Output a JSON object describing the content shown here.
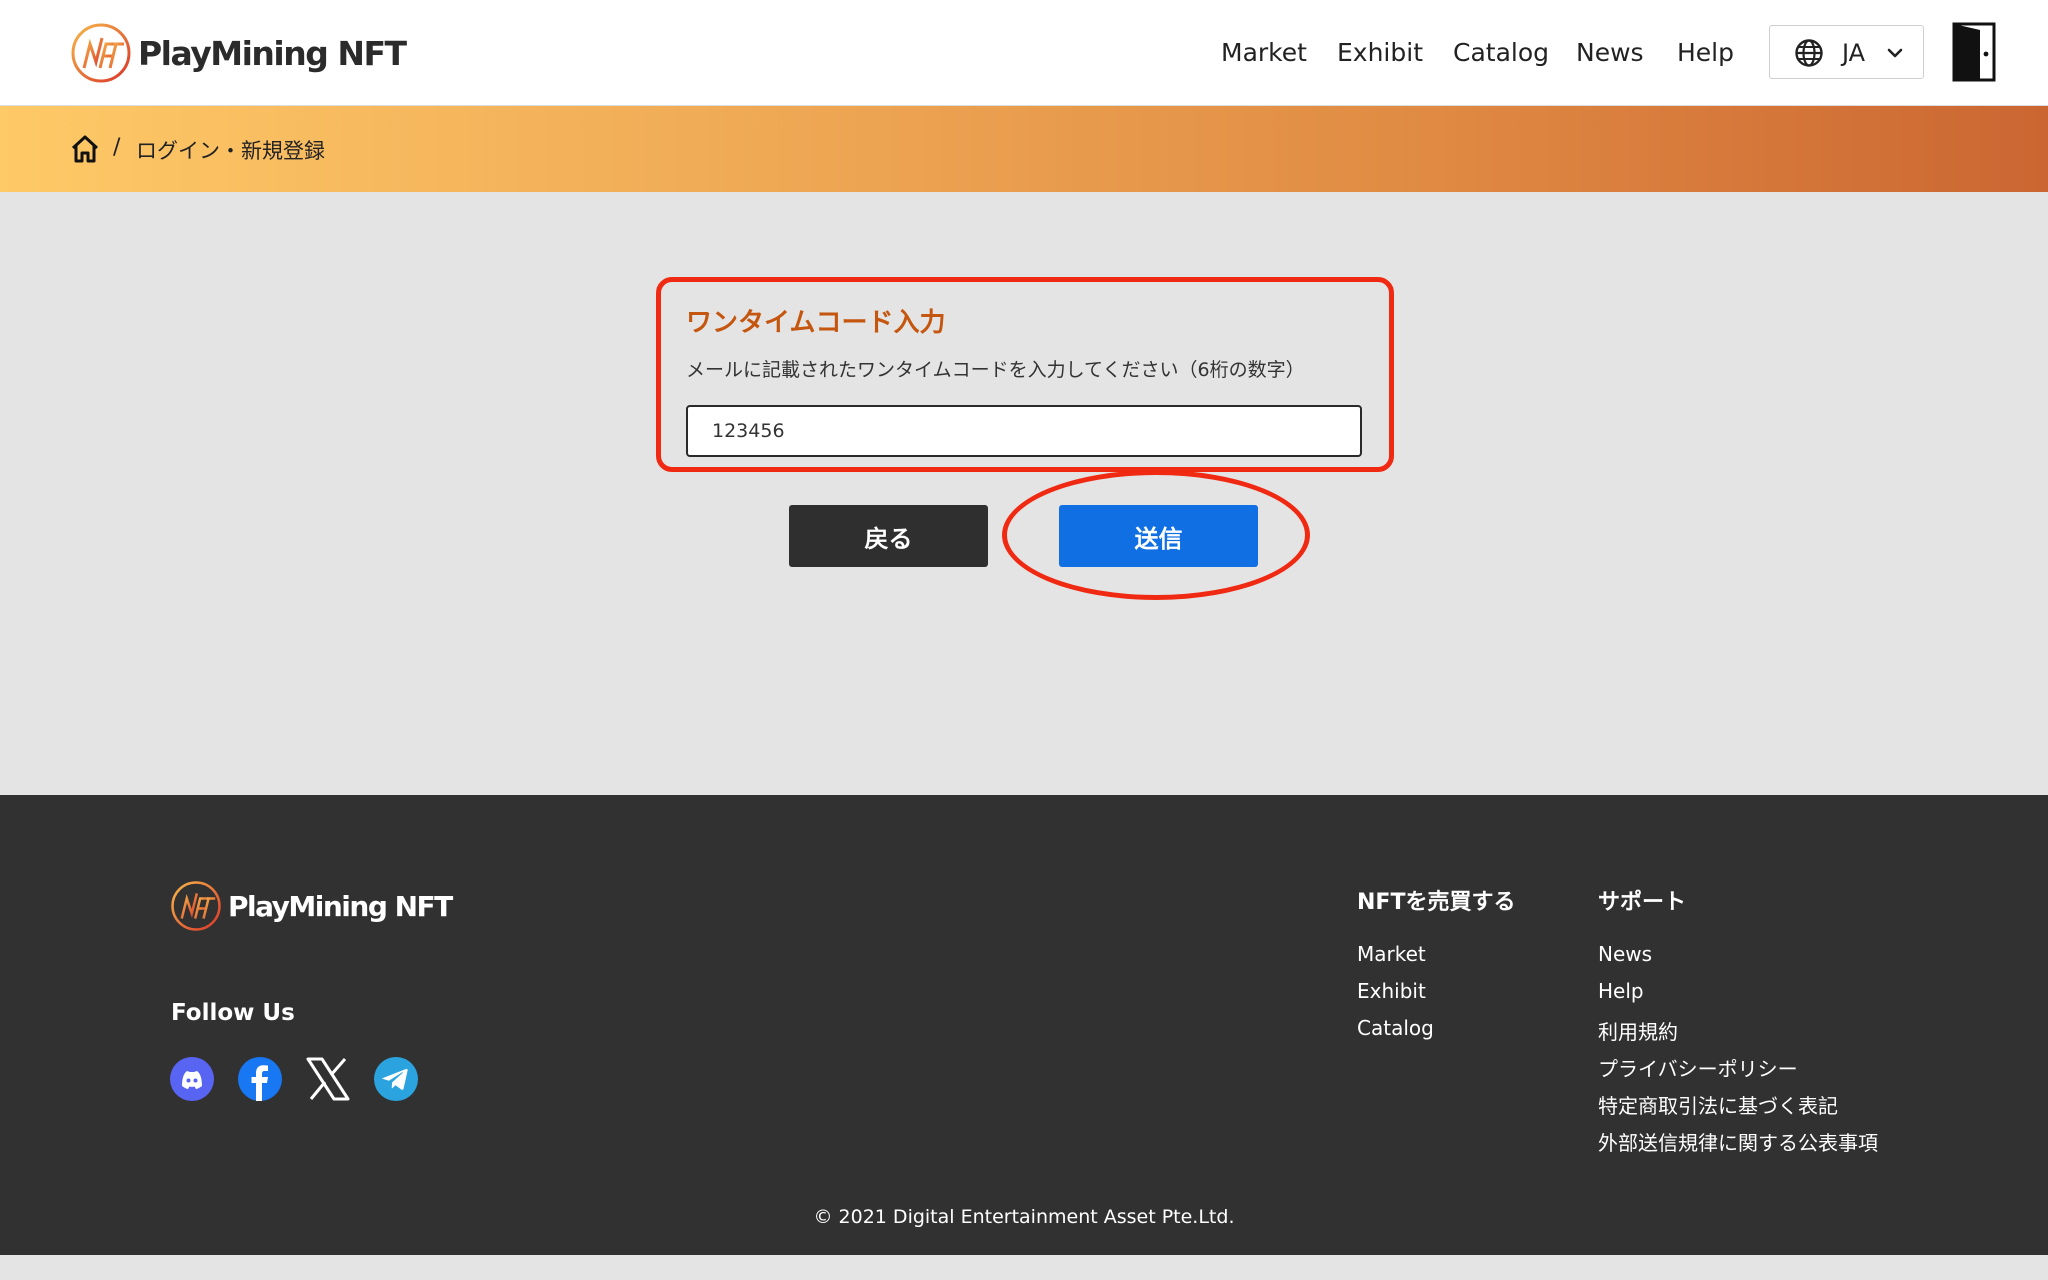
{
  "brand": {
    "name": "PlayMining NFT",
    "accent": "#c4560f",
    "highlight": "#f02a12"
  },
  "header": {
    "nav": [
      "Market",
      "Exhibit",
      "Catalog",
      "News",
      "Help"
    ],
    "language": "JA",
    "icons": [
      "globe-icon",
      "chevron-down-icon",
      "door-icon"
    ]
  },
  "breadcrumb": {
    "separator": "/",
    "current": "ログイン・新規登録"
  },
  "form": {
    "title": "ワンタイムコード入力",
    "description": "メールに記載されたワンタイムコードを入力してください（6桁の数字）",
    "code_value": "123456"
  },
  "buttons": {
    "back": "戻る",
    "send": "送信",
    "send_color": "#0f6fe3",
    "back_color": "#2f2f2f"
  },
  "footer": {
    "follow_us": "Follow Us",
    "social": [
      "discord-icon",
      "facebook-icon",
      "x-icon",
      "telegram-icon"
    ],
    "columns": [
      {
        "title": "NFTを売買する",
        "links": [
          "Market",
          "Exhibit",
          "Catalog"
        ]
      },
      {
        "title": "サポート",
        "links": [
          "News",
          "Help",
          "利用規約",
          "プライバシーポリシー",
          "特定商取引法に基づく表記",
          "外部送信規律に関する公表事項"
        ]
      }
    ],
    "copyright": "© 2021 Digital Entertainment Asset Pte.Ltd."
  }
}
